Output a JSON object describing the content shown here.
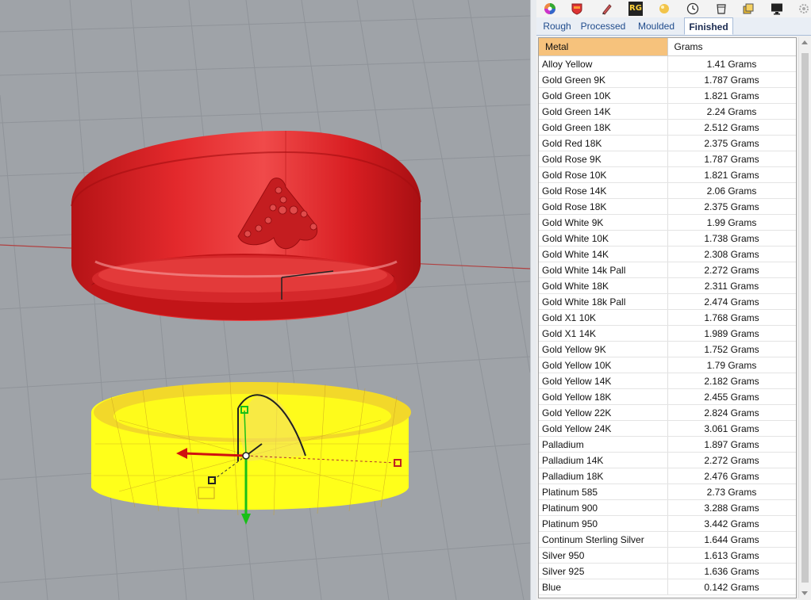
{
  "toolbar": {
    "icons": [
      "color-wheel-icon",
      "shield-icon",
      "pen-icon",
      "rg-icon",
      "sphere-icon",
      "clock-icon",
      "bucket-icon",
      "layers-icon",
      "monitor-icon",
      "settings-icon"
    ],
    "rg_label": "RG"
  },
  "tabs": [
    "Rough",
    "Processed",
    "Moulded",
    "Finished"
  ],
  "active_tab": "Finished",
  "table": {
    "columns": [
      "Metal",
      "Grams"
    ],
    "rows": [
      [
        "Alloy Yellow",
        "1.41 Grams"
      ],
      [
        "Gold Green 9K",
        "1.787 Grams"
      ],
      [
        "Gold Green 10K",
        "1.821 Grams"
      ],
      [
        "Gold Green 14K",
        "2.24 Grams"
      ],
      [
        "Gold Green 18K",
        "2.512 Grams"
      ],
      [
        "Gold Red 18K",
        "2.375 Grams"
      ],
      [
        "Gold Rose 9K",
        "1.787 Grams"
      ],
      [
        "Gold Rose 10K",
        "1.821 Grams"
      ],
      [
        "Gold Rose 14K",
        "2.06 Grams"
      ],
      [
        "Gold Rose 18K",
        "2.375 Grams"
      ],
      [
        "Gold White 9K",
        "1.99 Grams"
      ],
      [
        "Gold White 10K",
        "1.738 Grams"
      ],
      [
        "Gold White 14K",
        "2.308 Grams"
      ],
      [
        "Gold White 14k Pall",
        "2.272 Grams"
      ],
      [
        "Gold White 18K",
        "2.311 Grams"
      ],
      [
        "Gold White 18k Pall",
        "2.474 Grams"
      ],
      [
        "Gold X1 10K",
        "1.768 Grams"
      ],
      [
        "Gold X1 14K",
        "1.989 Grams"
      ],
      [
        "Gold Yellow 9K",
        "1.752 Grams"
      ],
      [
        "Gold Yellow 10K",
        "1.79 Grams"
      ],
      [
        "Gold Yellow 14K",
        "2.182 Grams"
      ],
      [
        "Gold Yellow 18K",
        "2.455 Grams"
      ],
      [
        "Gold Yellow 22K",
        "2.824 Grams"
      ],
      [
        "Gold Yellow 24K",
        "3.061 Grams"
      ],
      [
        "Palladium",
        "1.897 Grams"
      ],
      [
        "Palladium 14K",
        "2.272 Grams"
      ],
      [
        "Palladium 18K",
        "2.476 Grams"
      ],
      [
        "Platinum 585",
        "2.73 Grams"
      ],
      [
        "Platinum 900",
        "3.288 Grams"
      ],
      [
        "Platinum 950",
        "3.442 Grams"
      ],
      [
        "Continum Sterling Silver",
        "1.644 Grams"
      ],
      [
        "Silver 950",
        "1.613 Grams"
      ],
      [
        "Silver 925",
        "1.636 Grams"
      ],
      [
        "Blue",
        "0.142 Grams"
      ]
    ]
  },
  "colors": {
    "ring_render": "#e0262a",
    "ring_wireframe": "#ffff00",
    "header_highlight": "#f6c27c",
    "viewport_bg": "#9fa3a8"
  }
}
